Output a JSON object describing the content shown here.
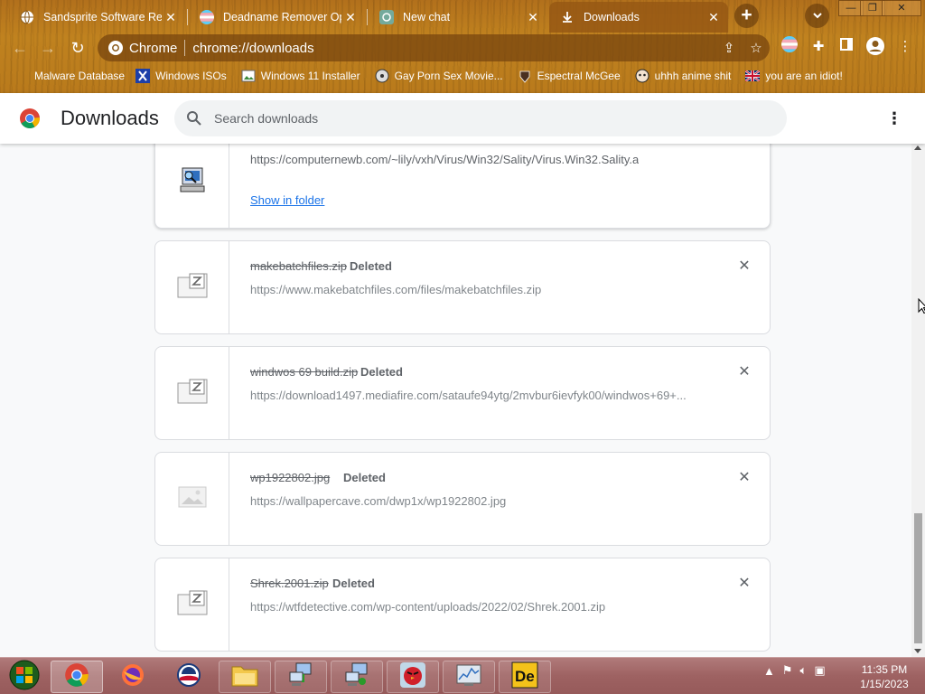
{
  "tabs": [
    {
      "title": "Sandsprite Software Rev",
      "favicon": "globe-icon",
      "active": false
    },
    {
      "title": "Deadname Remover Optio",
      "favicon": "trans-flag-icon",
      "active": false
    },
    {
      "title": "New chat",
      "favicon": "chatgpt-icon",
      "active": false
    },
    {
      "title": "Downloads",
      "favicon": "download-icon",
      "active": true
    }
  ],
  "toolbar": {
    "site_label": "Chrome",
    "url": "chrome://downloads"
  },
  "bookmarks": [
    {
      "label": "Malware Database",
      "icon": "globe-icon"
    },
    {
      "label": "Windows ISOs",
      "icon": "x-icon"
    },
    {
      "label": "Windows 11 Installer",
      "icon": "image-icon"
    },
    {
      "label": "Gay Porn Sex Movie...",
      "icon": "folder-icon"
    },
    {
      "label": "Espectral McGee",
      "icon": "character-icon"
    },
    {
      "label": "uhhh anime shit",
      "icon": "anime-icon"
    },
    {
      "label": "you are an idiot!",
      "icon": "uk-flag-icon"
    }
  ],
  "downloads_page": {
    "title": "Downloads",
    "search_placeholder": "Search downloads"
  },
  "downloads": [
    {
      "name": "",
      "status": "",
      "url": "https://computernewb.com/~lily/vxh/Virus/Win32/Sality/Virus.Win32.Sality.a",
      "action": "Show in folder",
      "icon": "program-icon",
      "deleted": false
    },
    {
      "name": "makebatchfiles.zip",
      "status": "Deleted",
      "url": "https://www.makebatchfiles.com/files/makebatchfiles.zip",
      "icon": "zip-file-icon",
      "deleted": true
    },
    {
      "name": "windwos 69 build.zip",
      "status": "Deleted",
      "url": "https://download1497.mediafire.com/sataufe94ytg/2mvbur6ievfyk00/windwos+69+...",
      "icon": "zip-file-icon",
      "deleted": true
    },
    {
      "name": "wp1922802.jpg",
      "status": "Deleted",
      "url": "https://wallpapercave.com/dwp1x/wp1922802.jpg",
      "icon": "image-file-icon",
      "deleted": true
    },
    {
      "name": "Shrek.2001.zip",
      "status": "Deleted",
      "url": "https://wtfdetective.com/wp-content/uploads/2022/02/Shrek.2001.zip",
      "icon": "zip-file-icon",
      "deleted": true
    }
  ],
  "taskbar": {
    "apps": [
      "start-orb-icon",
      "chrome-icon",
      "firefox-icon",
      "obama-logo-icon",
      "file-explorer-icon",
      "network-computer-icon",
      "network-computer-icon",
      "angry-birds-icon",
      "performance-monitor-icon",
      "deskedit-icon"
    ]
  },
  "clock": {
    "time": "11:35 PM",
    "date": "1/15/2023"
  },
  "colors": {
    "frame_wood": "#b97a1c",
    "link_blue": "#1a73e8",
    "taskbar": "#9e6262"
  }
}
